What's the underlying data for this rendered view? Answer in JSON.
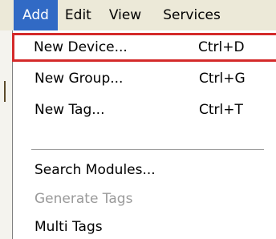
{
  "menubar": {
    "items": [
      {
        "label": "Add"
      },
      {
        "label": "Edit"
      },
      {
        "label": "View"
      },
      {
        "label": "Services"
      }
    ]
  },
  "dropdown": {
    "items": [
      {
        "label": "New Device...",
        "shortcut": "Ctrl+D"
      },
      {
        "label": "New Group...",
        "shortcut": "Ctrl+G"
      },
      {
        "label": "New Tag...",
        "shortcut": "Ctrl+T"
      },
      {
        "label": "Search Modules..."
      },
      {
        "label": "Generate Tags"
      },
      {
        "label": "Multi Tags"
      }
    ]
  },
  "colors": {
    "menubar_background": "#ece9d8",
    "selection_background": "#316ac5",
    "highlight_border": "#d42a2a",
    "disabled_text": "#9a9a9a"
  }
}
